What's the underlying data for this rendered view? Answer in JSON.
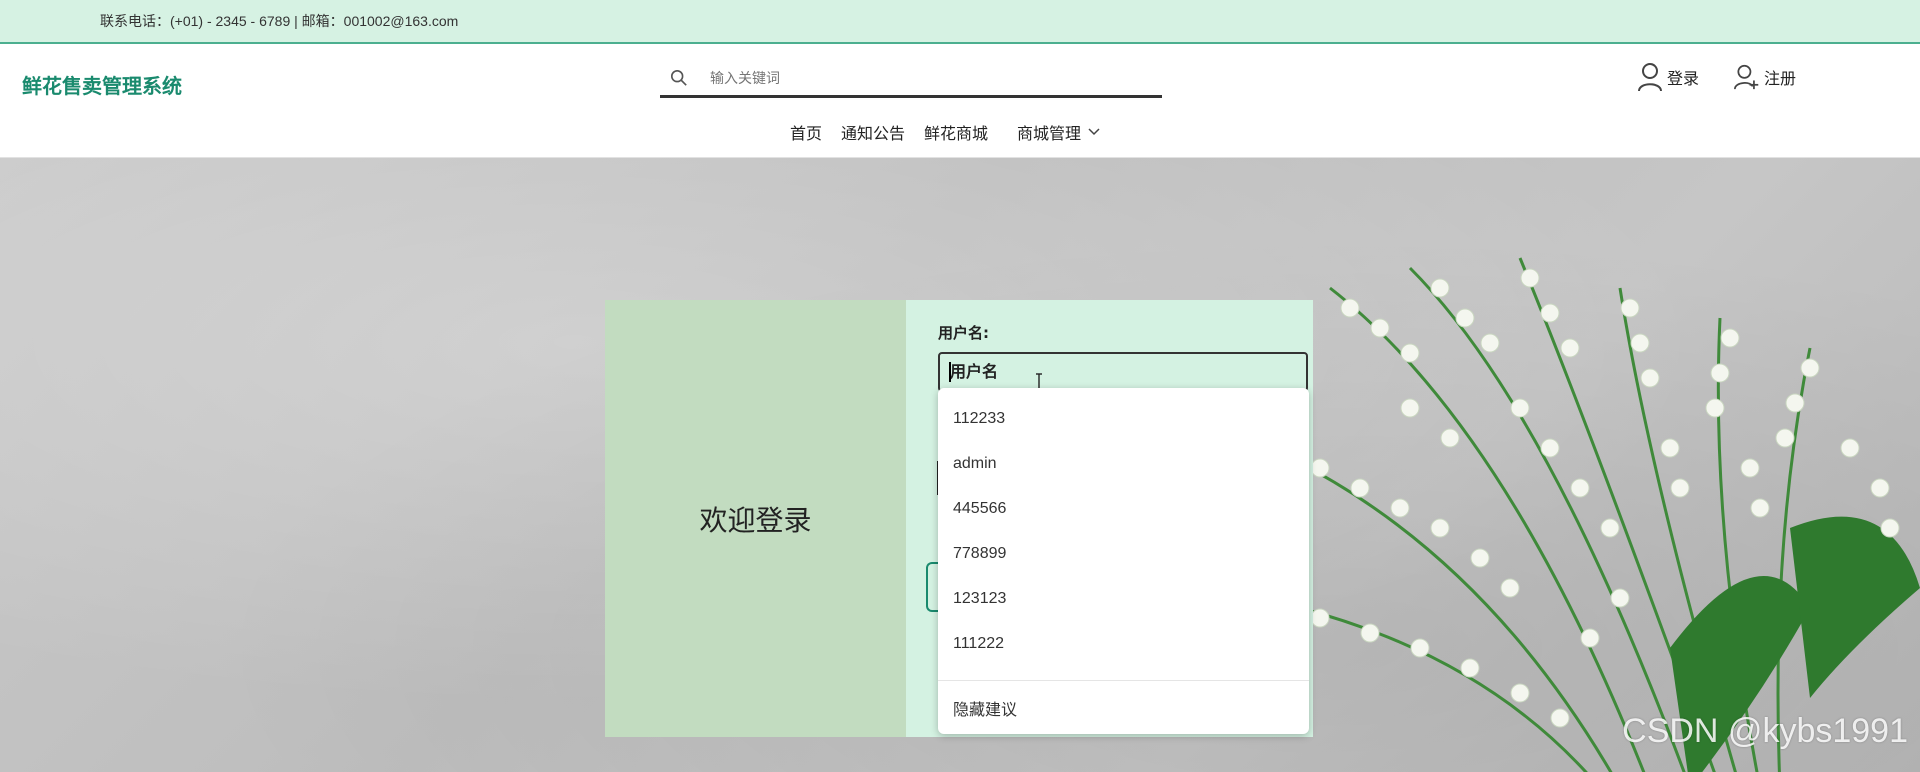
{
  "topbar": {
    "contact": "联系电话：(+01) - 2345 - 6789 | 邮箱：001002@163.com"
  },
  "header": {
    "logo": "鲜花售卖管理系统",
    "search_placeholder": "输入关键词",
    "login_label": "登录",
    "register_label": "注册"
  },
  "nav": {
    "items": [
      "首页",
      "通知公告",
      "鲜花商城",
      "商城管理"
    ]
  },
  "login": {
    "welcome": "欢迎登录",
    "username_label": "用户名:",
    "username_value": "用户名"
  },
  "suggestions": {
    "items": [
      "112233",
      "admin",
      "445566",
      "778899",
      "123123",
      "111222"
    ],
    "hide_label": "隐藏建议"
  },
  "watermark": "CSDN @kybs1991",
  "colors": {
    "accent": "#1a8a6e",
    "topbar_bg": "#d6f2e3",
    "card_left": "#c2dcc0",
    "card_right": "#d4f2e2"
  }
}
